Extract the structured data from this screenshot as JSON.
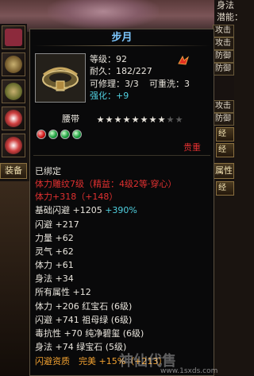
{
  "item": {
    "name": "步月",
    "level": "等级：92",
    "durability": "耐久：182/227",
    "repairable": "可修理：3/3",
    "rewashable": "可重洗：3",
    "enhance_label": "强化：",
    "enhance_value": "+9",
    "slot": "腰带",
    "stars_on": 8,
    "stars_total": 10,
    "gems": [
      "red",
      "green",
      "green",
      "green"
    ],
    "note_red": "贵重",
    "bound": "已绑定",
    "engrave": "体力雕纹7级（精益：4级2等·穿心）",
    "engrave_stat": "体力+318（+148）",
    "base_stat": "基础闪避 +1205",
    "base_bonus": "+390%",
    "attrs": [
      "闪避 +217",
      "力量 +62",
      "灵气 +62",
      "体力 +61",
      "身法 +34",
      "所有属性 +12"
    ],
    "gem_attrs": [
      "体力 +206 红宝石 (6级)",
      "闪避 +741 祖母绿 (6级)",
      "毒抗性 +70 纯净碧玺 (6级)",
      "身法 +74 绿宝石 (5级)"
    ],
    "qualification": "闪避资质　完美 +15%（+213）"
  },
  "left": {
    "equip_tab": "装备"
  },
  "right": {
    "top_labels": [
      "身法",
      "潜能："
    ],
    "rows": [
      "攻击",
      "攻击",
      "防御",
      "防御",
      "攻击",
      "防御"
    ],
    "buttons": [
      "经验",
      "经验",
      "经验"
    ],
    "tab": "属性"
  },
  "watermark": {
    "text": "神仙代售",
    "url": "www.1sxds.com"
  },
  "colors": {
    "title": "#7ec8ff",
    "red": "#e03030",
    "green": "#4ee07a",
    "cyan": "#50d0e0",
    "orange": "#f0a030"
  }
}
